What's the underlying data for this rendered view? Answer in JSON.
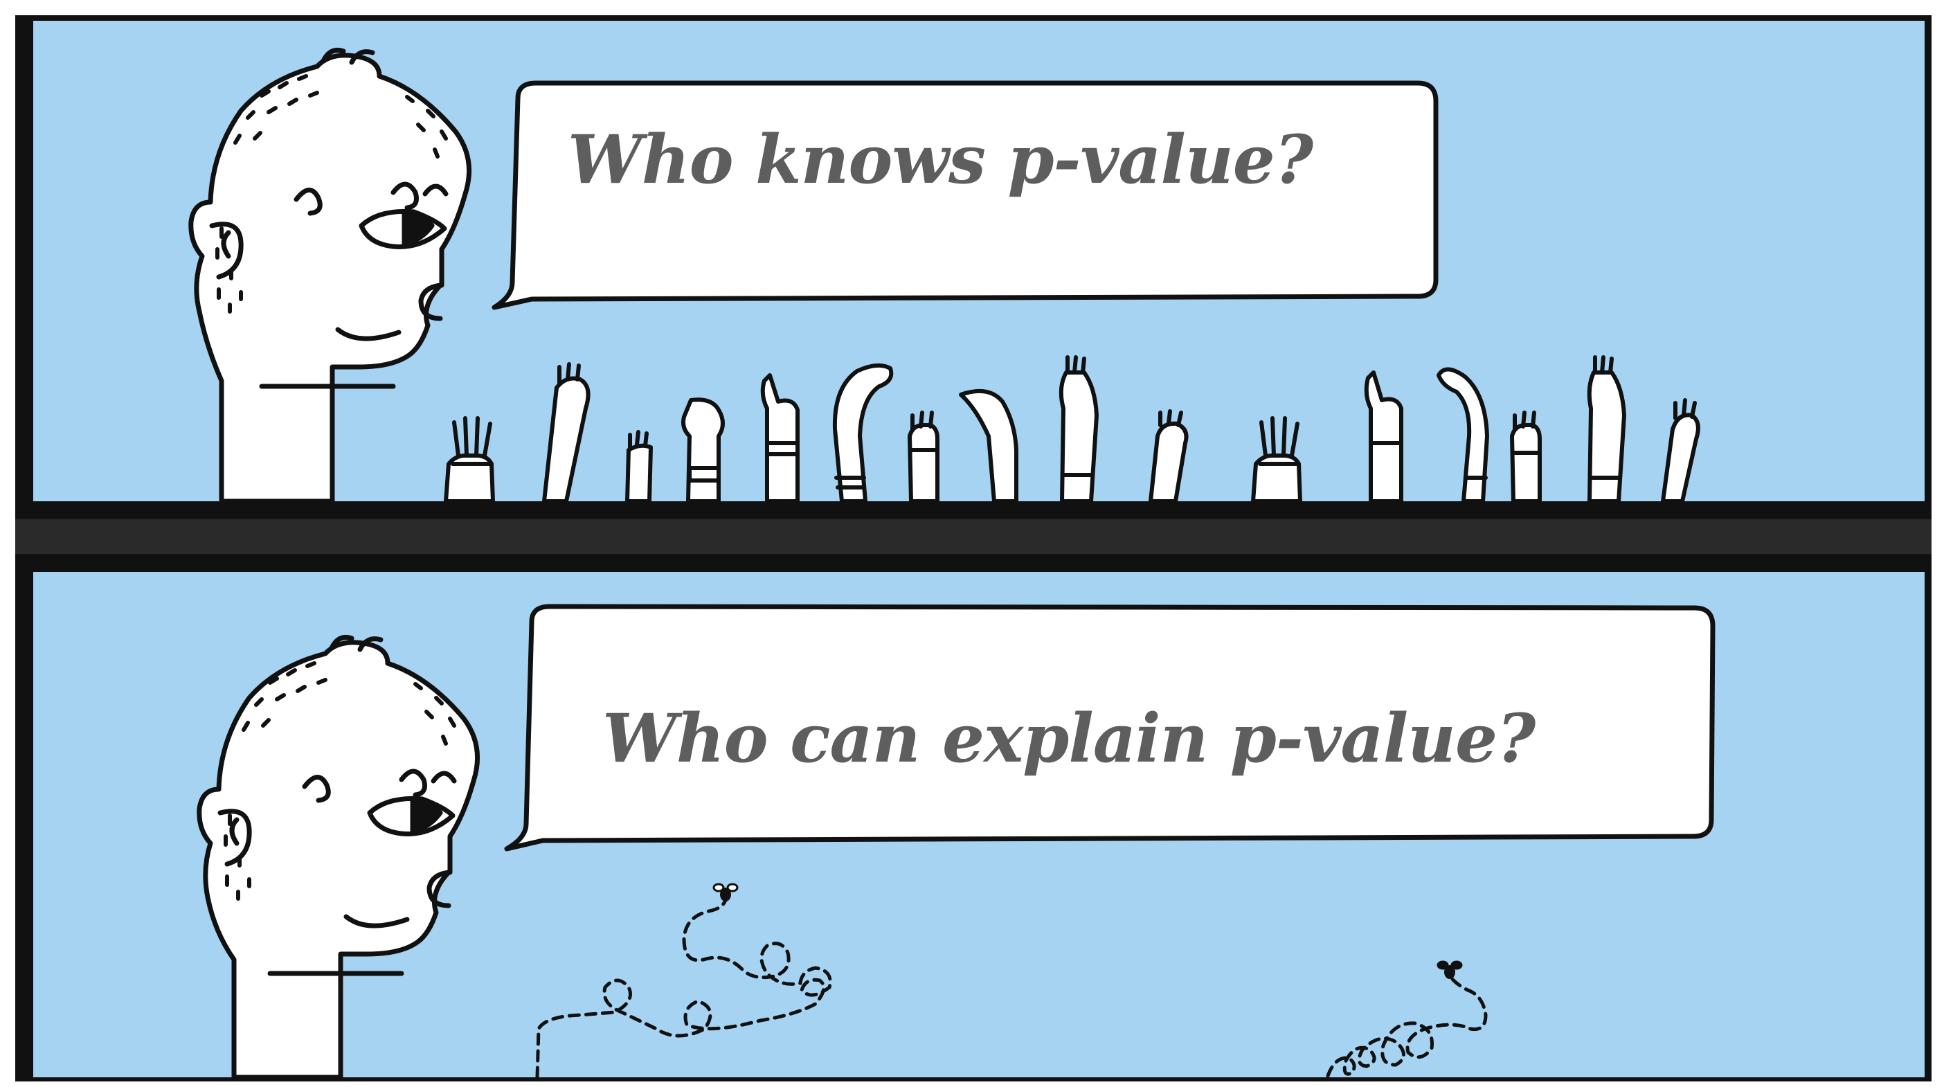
{
  "panels": [
    {
      "speech": "Who knows p-value?",
      "scene": "raised-hands"
    },
    {
      "speech": "Who can explain p-value?",
      "scene": "flies"
    }
  ],
  "colors": {
    "sky": "#a6d3f2",
    "ink": "#111111",
    "paper": "#ffffff",
    "text": "#5e5e5e"
  }
}
